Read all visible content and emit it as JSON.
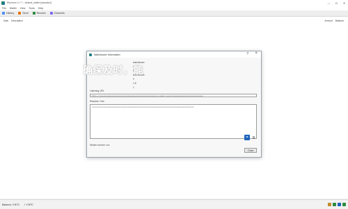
{
  "window": {
    "title": "Electrum 4.?.? - default_wallet [standard]",
    "controls": [
      "—",
      "☐",
      "✕"
    ]
  },
  "menu": [
    "File",
    "Wallet",
    "View",
    "Tools",
    "Help"
  ],
  "tabs": [
    {
      "label": "History",
      "icon_color": "#4c8bf5"
    },
    {
      "label": "Send",
      "icon_color": "#e8710a"
    },
    {
      "label": "Receive",
      "icon_color": "#2b8a3e"
    },
    {
      "label": "Channels",
      "icon_color": "#7b68ee"
    }
  ],
  "history": {
    "columns": {
      "date": "Date",
      "description": "Description",
      "amount": "Amount",
      "balance": "Balance"
    }
  },
  "status": {
    "balance": "Balance: 0 BTC",
    "lightning": "⚡ 0 BTC",
    "icon_colors": [
      "#c08b2a",
      "#2b8a3e",
      "#1c62b9",
      "#2b8a3e"
    ]
  },
  "dialog": {
    "title": "Watchtower information",
    "info": [
      {
        "label": "",
        "value": "watchtower"
      },
      {
        "label": "",
        "value": "1.2.10"
      },
      {
        "label": "",
        "value": "5.1.1.1"
      },
      {
        "label": "",
        "value": "watchtower"
      },
      {
        "label": "",
        "value": "0"
      },
      {
        "label": "",
        "value": "1.8"
      },
      {
        "label": "",
        "value": "1"
      }
    ],
    "overlay_text": "确保及时，能",
    "listening_label": "Listening URL",
    "listening_value": "http://xxxxxxxxxxxxxxxxxxxxxxxxxxxxxxxxxxxxxxxxxxxxxxxxxxxx.onion:xxxx/xxxxxxxxxxxxxxxxxxxxxxxxxxxx",
    "readme_label": "Readme / Info",
    "readme_value": "xxxxxxxxxxxxxxxxxxxxxxxxxxxxxxxxxxxxxxxxxxxxxxxxxxxxxxxxxxxxxxxxxxxxxxxxxxxxxxxxxxxxxxxxxxx",
    "qr_label": "⌗",
    "copy_label": "⧉",
    "onion_label": "Hidden service: xxx",
    "close_label": "Close"
  }
}
